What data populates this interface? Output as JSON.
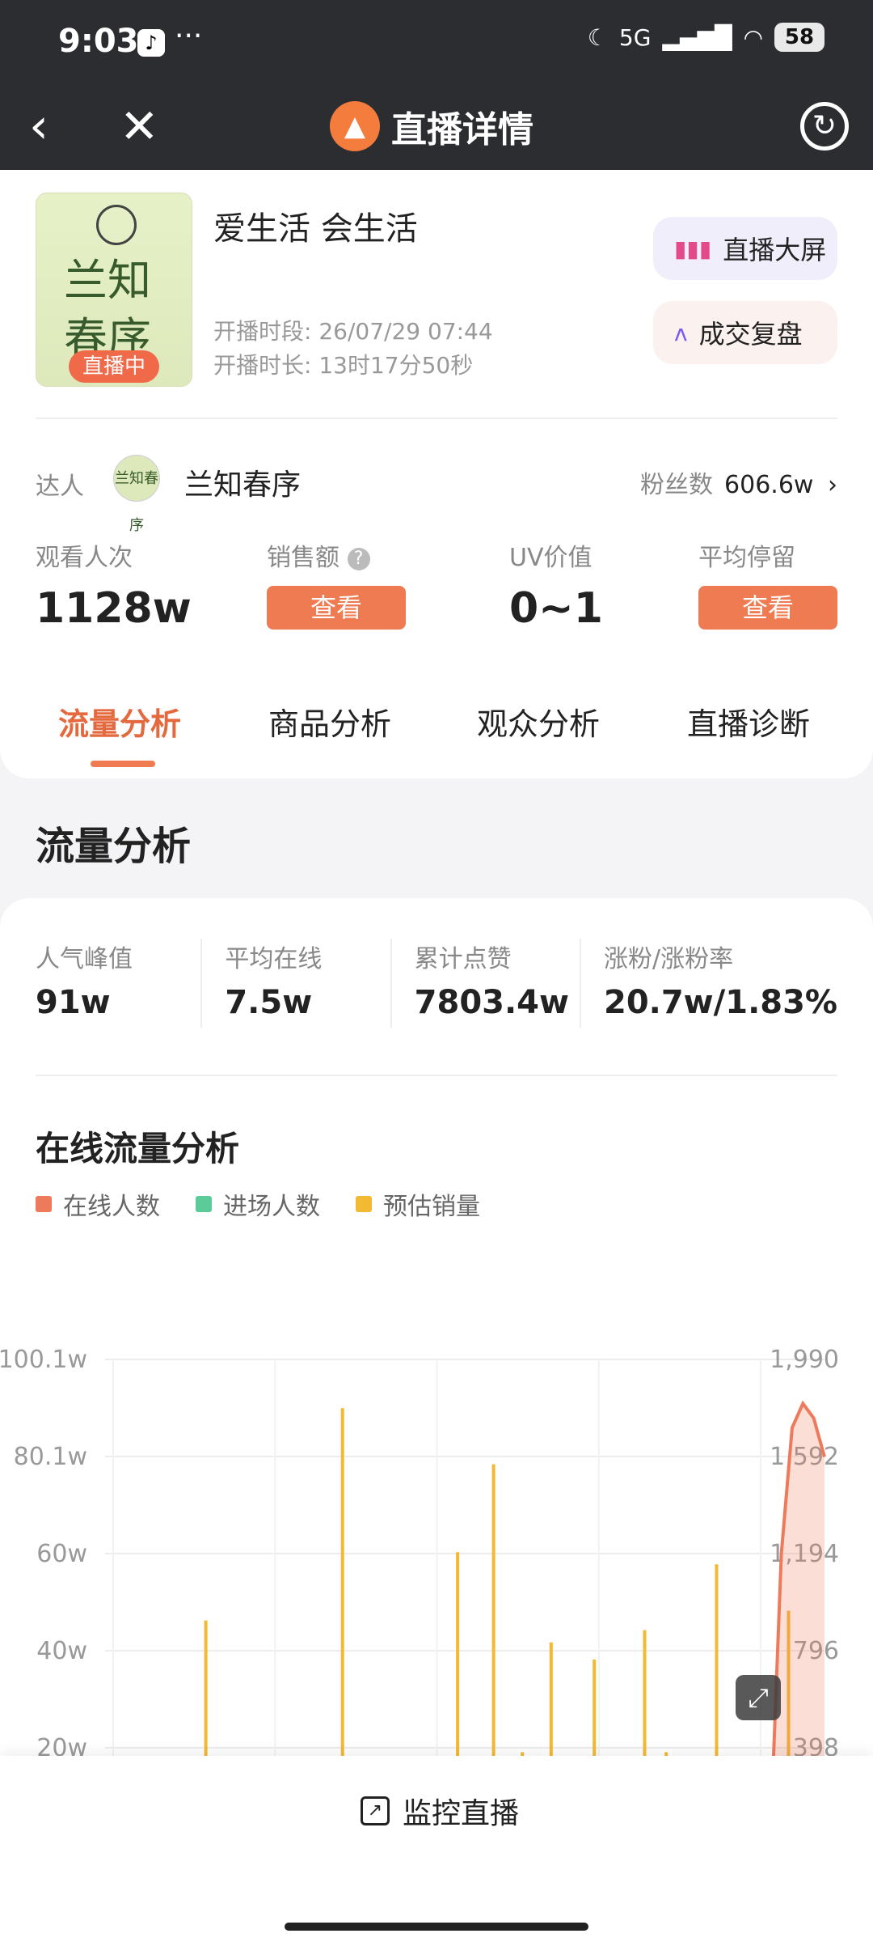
{
  "status_bar": {
    "time": "9:03",
    "app_badge": "♪",
    "more": "···",
    "network": "5G",
    "battery": "58"
  },
  "nav": {
    "title": "直播详情"
  },
  "live": {
    "cover_text": "兰知\n春序",
    "cover_badge": "直播中",
    "title": "爱生活 会生活",
    "start_label": "开播时段:",
    "start_value": "26/07/29 07:44",
    "duration_label": "开播时长:",
    "duration_value": "13时17分50秒",
    "btn_screen": "直播大屏",
    "btn_review": "成交复盘"
  },
  "host": {
    "label": "达人",
    "avatar_text": "兰知春序",
    "name": "兰知春序",
    "fans_label": "粉丝数",
    "fans_value": "606.6w"
  },
  "stats": {
    "views_label": "观看人次",
    "views_value": "1128w",
    "sales_label": "销售额",
    "sales_btn": "查看",
    "uv_label": "UV价值",
    "uv_value": "0~1",
    "stay_label": "平均停留",
    "stay_btn": "查看"
  },
  "tabs": [
    "流量分析",
    "商品分析",
    "观众分析",
    "直播诊断"
  ],
  "section_title": "流量分析",
  "kpis": [
    {
      "label": "人气峰值",
      "value": "91w"
    },
    {
      "label": "平均在线",
      "value": "7.5w"
    },
    {
      "label": "累计点赞",
      "value": "7803.4w"
    },
    {
      "label": "涨粉/涨粉率",
      "value": "20.7w/1.83%"
    }
  ],
  "chart_title": "在线流量分析",
  "legend": [
    {
      "name": "在线人数",
      "color": "#ee7a5c"
    },
    {
      "name": "进场人数",
      "color": "#5ccb9a"
    },
    {
      "name": "预估销量",
      "color": "#f2b933"
    }
  ],
  "bottom": {
    "monitor_label": "监控直播"
  },
  "chart_data": {
    "type": "line",
    "left_axis": {
      "ticks": [
        "100.1w",
        "80.1w",
        "60w",
        "40w",
        "20w",
        "0"
      ],
      "ylim": [
        0,
        100.1
      ]
    },
    "right_axis": {
      "ticks": [
        "1,990",
        "1,592",
        "1,194",
        "796",
        "398",
        "0"
      ],
      "ylim": [
        0,
        1990
      ]
    },
    "series": [
      {
        "name": "在线人数",
        "axis": "left",
        "type": "area",
        "x": [
          0.0,
          0.9,
          0.925,
          0.94,
          0.955,
          0.97,
          0.985,
          1.0
        ],
        "values": [
          0.5,
          0.5,
          2,
          60,
          86,
          91,
          88,
          80
        ]
      },
      {
        "name": "进场人数",
        "axis": "left",
        "type": "area",
        "x": [
          0.0,
          0.9,
          0.93,
          0.95,
          0.97,
          1.0
        ],
        "values": [
          0.4,
          0.4,
          10,
          12,
          8,
          11
        ]
      },
      {
        "name": "预估销量",
        "axis": "right",
        "type": "spikes",
        "x": [
          0.03,
          0.06,
          0.11,
          0.14,
          0.21,
          0.26,
          0.33,
          0.35,
          0.38,
          0.44,
          0.49,
          0.5,
          0.54,
          0.58,
          0.6,
          0.62,
          0.68,
          0.72,
          0.75,
          0.78,
          0.81,
          0.85,
          0.9,
          0.95
        ],
        "values": [
          60,
          240,
          180,
          920,
          130,
          300,
          1790,
          260,
          160,
          310,
          1200,
          220,
          1560,
          380,
          140,
          830,
          760,
          250,
          880,
          380,
          190,
          1150,
          230,
          960
        ]
      }
    ]
  }
}
